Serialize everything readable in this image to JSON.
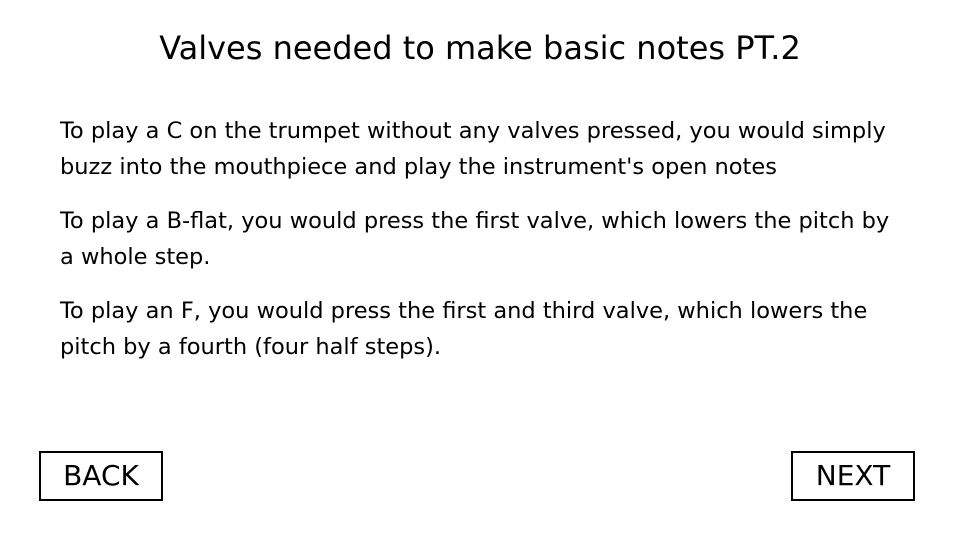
{
  "slide": {
    "title": "Valves needed to make basic notes PT.2",
    "paragraphs": [
      "To play a C on the trumpet without any valves pressed, you would simply buzz into the mouthpiece and play the instrument's open notes",
      "To play a B-flat, you would press the first valve, which lowers the pitch by a whole step.",
      "To play an F, you would press the first and third valve, which lowers the pitch by a fourth (four half steps)."
    ]
  },
  "navigation": {
    "back_label": "BACK",
    "next_label": "NEXT"
  }
}
